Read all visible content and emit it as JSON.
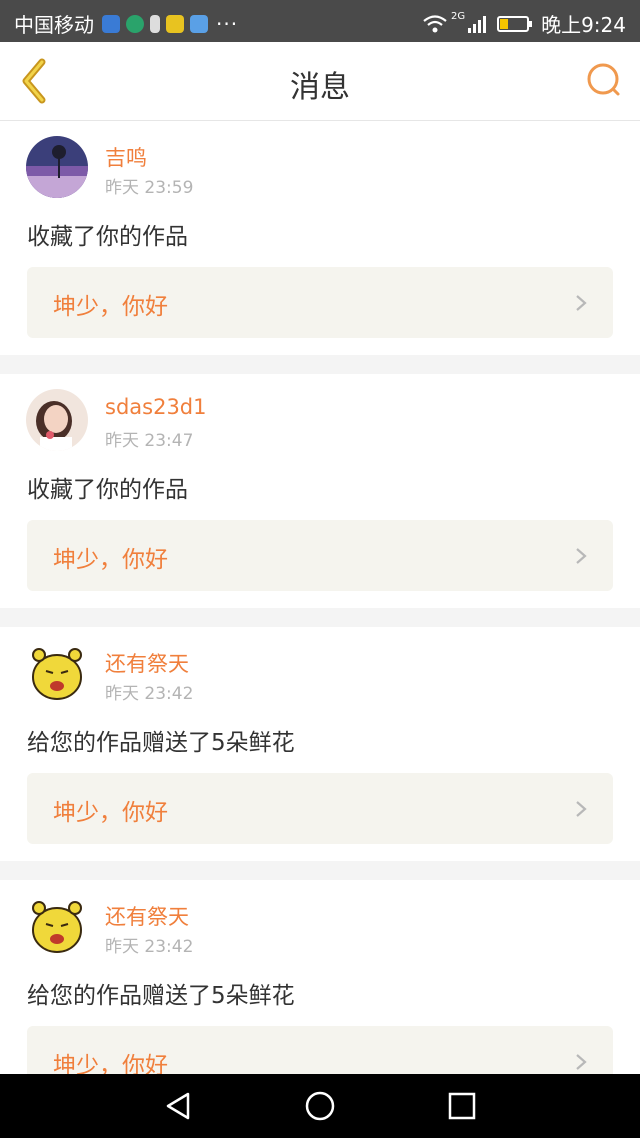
{
  "status_bar": {
    "carrier": "中国移动",
    "dots": "···",
    "network": "2G",
    "time": "晚上9:24"
  },
  "header": {
    "title": "消息"
  },
  "messages": [
    {
      "name": "吉鸣",
      "time": "昨天 23:59",
      "text": "收藏了你的作品",
      "reply": "坤少，你好"
    },
    {
      "name": "sdas23d1",
      "time": "昨天 23:47",
      "text": "收藏了你的作品",
      "reply": "坤少，你好"
    },
    {
      "name": "还有祭天",
      "time": "昨天 23:42",
      "text": "给您的作品赠送了5朵鲜花",
      "reply": "坤少，你好"
    },
    {
      "name": "还有祭天",
      "time": "昨天 23:42",
      "text": "给您的作品赠送了5朵鲜花",
      "reply": "坤少，你好"
    }
  ],
  "colors": {
    "accent": "#f07f3c",
    "status_bar_bg": "#4a4a4a",
    "reply_bg": "#f5f4ee"
  }
}
